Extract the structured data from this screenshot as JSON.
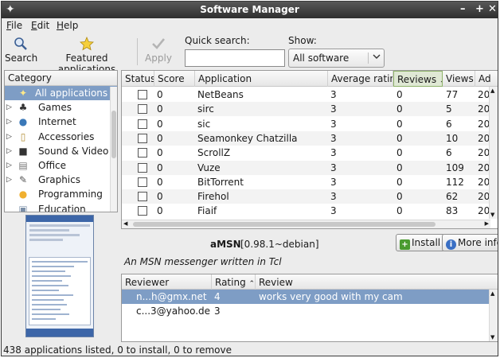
{
  "window": {
    "title": "Software Manager",
    "icon": "star-icon",
    "controls": [
      "–",
      "+",
      "✕"
    ]
  },
  "menu": [
    {
      "hotkey": "F",
      "rest": "ile"
    },
    {
      "hotkey": "E",
      "rest": "dit"
    },
    {
      "hotkey": "H",
      "rest": "elp"
    }
  ],
  "toolbar": {
    "search_label": "Search",
    "featured_label": "Featured applications",
    "apply_label": "Apply",
    "quick_search_label": "Quick search:",
    "quick_search_value": "",
    "show_label": "Show:",
    "show_value": "All software"
  },
  "categories": {
    "header": "Category",
    "items": [
      {
        "label": "All applications",
        "icon": "star-icon",
        "expandable": false,
        "selected": true
      },
      {
        "label": "Games",
        "icon": "games-icon",
        "expandable": true,
        "selected": false
      },
      {
        "label": "Internet",
        "icon": "globe-icon",
        "expandable": true,
        "selected": false
      },
      {
        "label": "Accessories",
        "icon": "accessories-icon",
        "expandable": true,
        "selected": false
      },
      {
        "label": "Sound & Video",
        "icon": "multimedia-icon",
        "expandable": true,
        "selected": false
      },
      {
        "label": "Office",
        "icon": "office-icon",
        "expandable": true,
        "selected": false
      },
      {
        "label": "Graphics",
        "icon": "graphics-icon",
        "expandable": true,
        "selected": false
      },
      {
        "label": "Programming",
        "icon": "programming-icon",
        "expandable": false,
        "selected": false
      },
      {
        "label": "Education",
        "icon": "education-icon",
        "expandable": false,
        "selected": false
      }
    ]
  },
  "app_table": {
    "columns": [
      "Status",
      "Score",
      "Application",
      "Average rating",
      "Reviews",
      "Views",
      "Ad"
    ],
    "sorted_column": "Reviews",
    "rows": [
      {
        "score": "0",
        "app": "NetBeans",
        "rating": "3",
        "reviews": "0",
        "views": "77",
        "added": "20"
      },
      {
        "score": "0",
        "app": "sirc",
        "rating": "3",
        "reviews": "0",
        "views": "5",
        "added": "20"
      },
      {
        "score": "0",
        "app": "sic",
        "rating": "3",
        "reviews": "0",
        "views": "6",
        "added": "20"
      },
      {
        "score": "0",
        "app": "Seamonkey Chatzilla",
        "rating": "3",
        "reviews": "0",
        "views": "10",
        "added": "20"
      },
      {
        "score": "0",
        "app": "ScrollZ",
        "rating": "3",
        "reviews": "0",
        "views": "6",
        "added": "20"
      },
      {
        "score": "0",
        "app": "Vuze",
        "rating": "3",
        "reviews": "0",
        "views": "109",
        "added": "20"
      },
      {
        "score": "0",
        "app": "BitTorrent",
        "rating": "3",
        "reviews": "0",
        "views": "112",
        "added": "20"
      },
      {
        "score": "0",
        "app": "Firehol",
        "rating": "3",
        "reviews": "0",
        "views": "62",
        "added": "20"
      },
      {
        "score": "0",
        "app": "Fiaif",
        "rating": "3",
        "reviews": "0",
        "views": "83",
        "added": "20"
      }
    ]
  },
  "details": {
    "name": "aMSN",
    "version": "[0.98.1~debian]",
    "install_label": "Install",
    "more_info_label": "More info",
    "summary": "An MSN messenger written in Tcl"
  },
  "reviews": {
    "columns": [
      "Reviewer",
      "Rating",
      "Review"
    ],
    "rows": [
      {
        "reviewer": "n...h@gmx.net",
        "rating": "4",
        "review": "works very good with my cam",
        "selected": true
      },
      {
        "reviewer": "c...3@yahoo.de",
        "rating": "3",
        "review": "",
        "selected": false
      }
    ]
  },
  "status": "438 applications listed, 0 to install, 0 to remove"
}
